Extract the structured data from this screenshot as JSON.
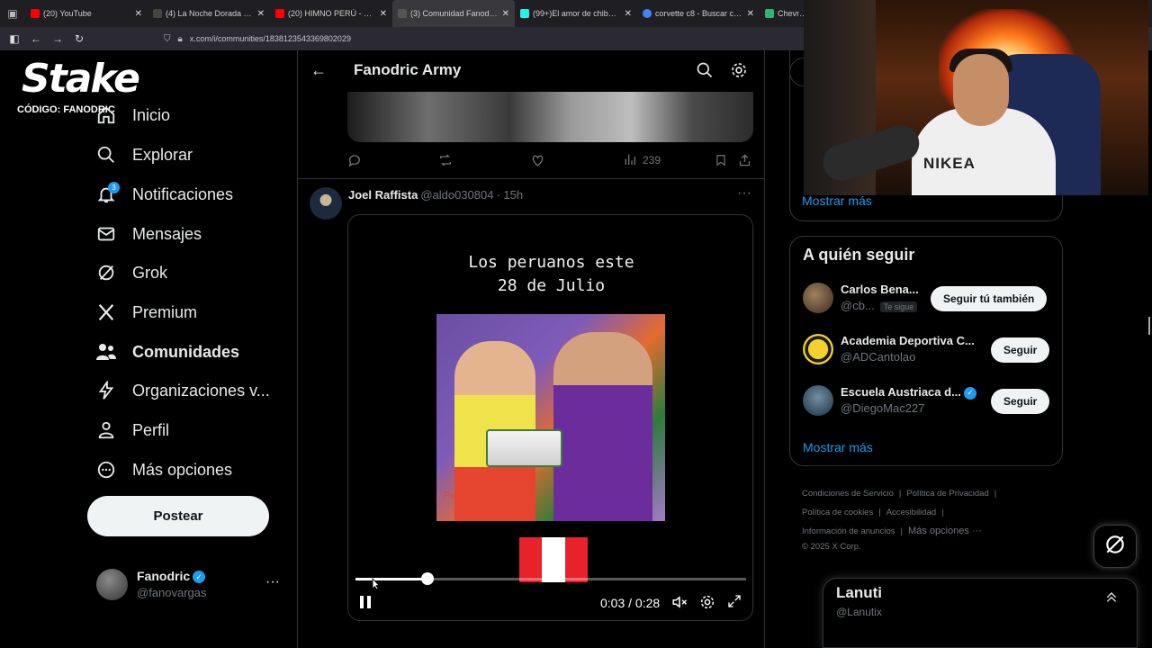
{
  "browser": {
    "tabs": [
      {
        "label": "(20) YouTube",
        "color": "#ff0000"
      },
      {
        "label": "(4) La Noche Dorada (@LaN",
        "color": "#ffffff"
      },
      {
        "label": "(20) HIMNO PERÚ - OFICIAL",
        "color": "#ff0000"
      },
      {
        "label": "(3) Comunidad Fanodric Arm",
        "color": "#ffffff"
      },
      {
        "label": "(99+)El amor de chibolo: Ho",
        "color": "#25f4ee"
      },
      {
        "label": "corvette c8 - Buscar con Go",
        "color": "#4285f4"
      },
      {
        "label": "Chevrolet",
        "color": "#2bb673"
      }
    ],
    "url": "x.com/i/communities/1838123543369802029"
  },
  "sponsor": {
    "logo": "Stake",
    "code_label": "CÓDIGO: FANODRIC"
  },
  "sidebar": {
    "items": [
      {
        "label": "Inicio",
        "icon": "home-icon"
      },
      {
        "label": "Explorar",
        "icon": "search-icon"
      },
      {
        "label": "Notificaciones",
        "icon": "bell-icon"
      },
      {
        "label": "Mensajes",
        "icon": "mail-icon"
      },
      {
        "label": "Grok",
        "icon": "grok-icon"
      },
      {
        "label": "Premium",
        "icon": "x-logo-icon"
      },
      {
        "label": "Comunidades",
        "icon": "people-icon"
      },
      {
        "label": "Organizaciones v...",
        "icon": "lightning-icon"
      },
      {
        "label": "Perfil",
        "icon": "person-icon"
      },
      {
        "label": "Más opciones",
        "icon": "more-circle-icon"
      }
    ],
    "notification_count": "3",
    "post_label": "Postear",
    "account": {
      "name": "Fanodric",
      "handle": "@fanovargas",
      "more": "···"
    }
  },
  "main": {
    "title": "Fanodric Army",
    "prev_tweet": {
      "views": "239"
    },
    "tweet": {
      "author": "Joel Raffista",
      "handle": "@aldo030804",
      "time": "· 15h",
      "caption_line1": "Los peruanos este",
      "caption_line2": "28 de Julio",
      "watermark": "Perú",
      "video": {
        "current": "0:03",
        "duration": "0:28",
        "time_display": "0:03 / 0:28",
        "progress": 0.107
      }
    }
  },
  "right": {
    "show_more_1": "Mostrar más",
    "who_to_follow": {
      "title": "A quién seguir",
      "items": [
        {
          "name": "Carlos Bena...",
          "handle": "@cb...",
          "follows_you": "Te sigue",
          "button": "Seguir tú también",
          "verified": false
        },
        {
          "name": "Academia Deportiva C...",
          "handle": "@ADCantolao",
          "follows_you": "",
          "button": "Seguir",
          "verified": false
        },
        {
          "name": "Escuela Austriaca d...",
          "handle": "@DiegoMac227",
          "follows_you": "",
          "button": "Seguir",
          "verified": true
        }
      ],
      "show_more": "Mostrar más"
    },
    "footer": {
      "links": [
        "Condiciones de Servicio",
        "Política de Privacidad",
        "Política de cookies",
        "Accesibilidad",
        "Información de anuncios",
        "Más opciones ···"
      ],
      "copyright": "© 2025 X Corp."
    },
    "messages": {
      "name": "Lanuti",
      "handle": "@Lanutix"
    }
  },
  "webcam": {
    "shirt_text": "NIKEA"
  },
  "colors": {
    "accent": "#1d9bf0",
    "background": "#000000",
    "text": "#e7e9ea",
    "muted": "#71767b"
  }
}
